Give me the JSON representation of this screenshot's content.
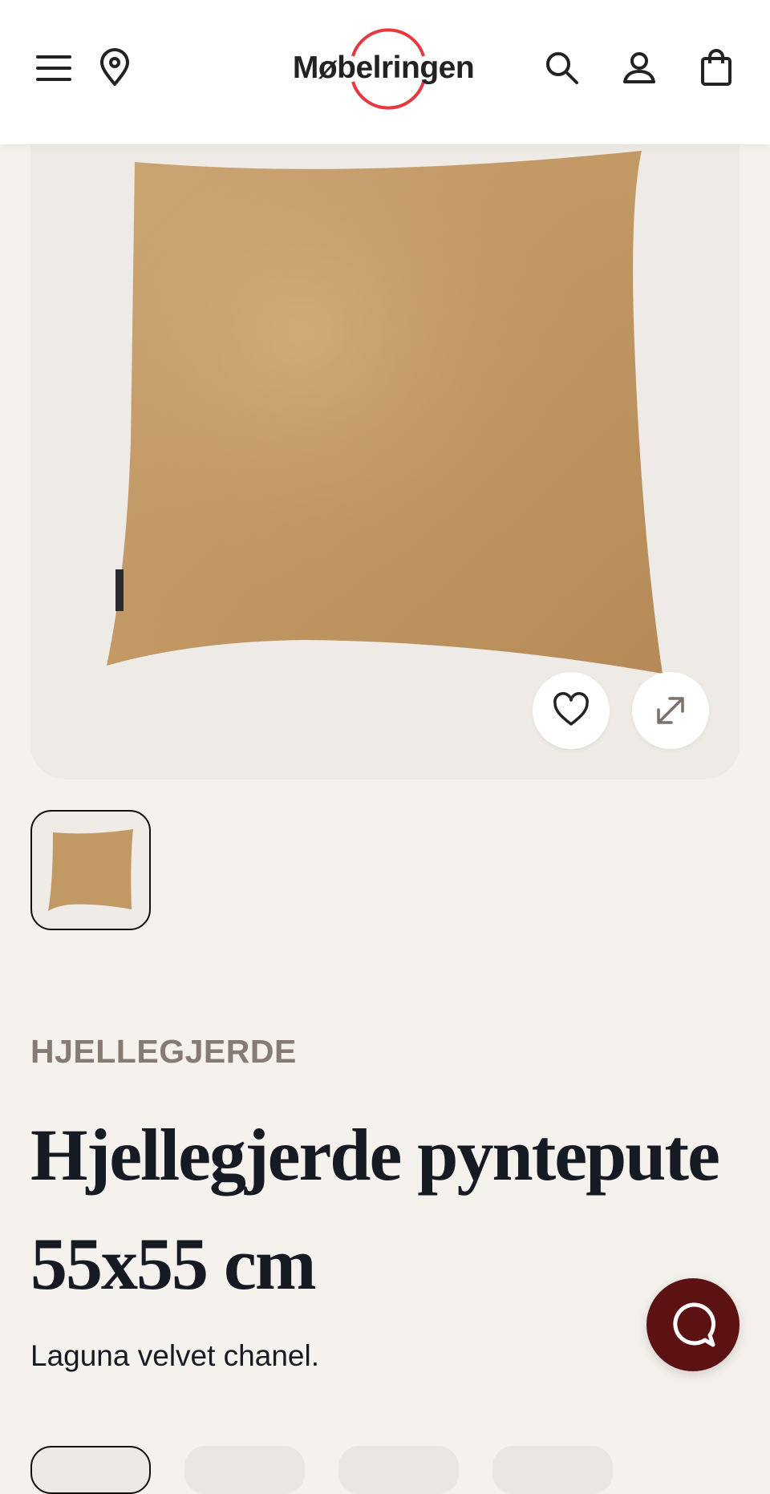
{
  "header": {
    "logo_text": "Møbelringen",
    "brand_color": "#e5393f",
    "icons": {
      "menu": "menu-icon",
      "location": "location-pin-icon",
      "search": "search-icon",
      "account": "user-icon",
      "cart": "shopping-bag-icon"
    }
  },
  "product": {
    "brand": "HJELLEGJERDE",
    "title": "Hjellegjerde pyntepute 55x55 cm",
    "description": "Laguna velvet chanel.",
    "image_alt": "Golden velvet cushion",
    "actions": {
      "favorite": "heart-icon",
      "expand": "expand-icon"
    }
  },
  "chat": {
    "icon": "chat-icon",
    "color": "#5c1212"
  },
  "colors": {
    "background": "#f5f1ed",
    "image_bg": "#eeeae5",
    "pillow": "#c59b68",
    "text": "#151a23",
    "brand_text": "#857a74"
  }
}
